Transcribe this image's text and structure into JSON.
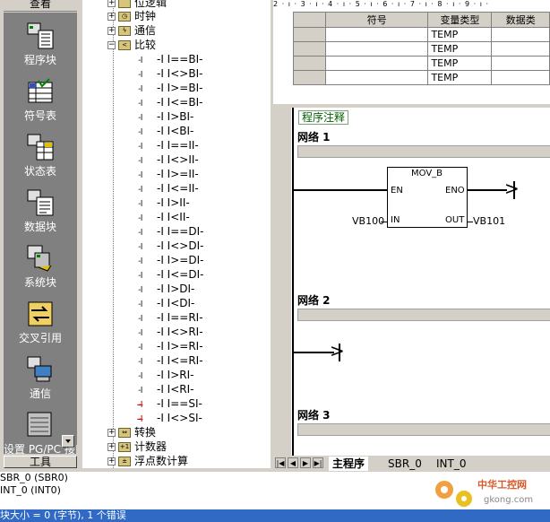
{
  "navbar": {
    "title": "查看",
    "items": [
      {
        "label": "程序块",
        "icon": "program-block-icon"
      },
      {
        "label": "符号表",
        "icon": "symbol-table-icon"
      },
      {
        "label": "状态表",
        "icon": "status-chart-icon"
      },
      {
        "label": "数据块",
        "icon": "data-block-icon"
      },
      {
        "label": "系统块",
        "icon": "system-block-icon"
      },
      {
        "label": "交叉引用",
        "icon": "cross-reference-icon"
      },
      {
        "label": "通信",
        "icon": "communication-icon"
      },
      {
        "label": "设置 PG/PC 接口",
        "icon": "set-pg-pc-icon"
      }
    ],
    "footer": "工具"
  },
  "tree": {
    "top_partial": "位逻辑",
    "folders_top": [
      "时钟",
      "通信"
    ],
    "compare_folder": "比较",
    "compare_items": [
      "-I  I==BI-",
      "-I  I<>BI-",
      "-I  I>=BI-",
      "-I  I<=BI-",
      "-I  I>BI-",
      "-I  I<BI-",
      "-I  I==II-",
      "-I  I<>II-",
      "-I  I>=II-",
      "-I  I<=II-",
      "-I  I>II-",
      "-I  I<II-",
      "-I  I==DI-",
      "-I  I<>DI-",
      "-I  I>=DI-",
      "-I  I<=DI-",
      "-I  I>DI-",
      "-I  I<DI-",
      "-I  I==RI-",
      "-I  I<>RI-",
      "-I  I>=RI-",
      "-I  I<=RI-",
      "-I  I>RI-",
      "-I  I<RI-",
      "-I  I==SI-",
      "-I  I<>SI-"
    ],
    "folders_bottom": [
      "转换",
      "计数器",
      "浮点数计算"
    ]
  },
  "symbol_table": {
    "ruler": "2 · ı · 3 · ı · 4 · ı · 5 · ı · 6 · ı · 7 · ı · 8 · ı · 9 · ı ·",
    "headers": [
      "符号",
      "变量类型",
      "数据类"
    ],
    "rows": [
      {
        "symbol": "",
        "var_type": "TEMP",
        "data_type": ""
      },
      {
        "symbol": "",
        "var_type": "TEMP",
        "data_type": ""
      },
      {
        "symbol": "",
        "var_type": "TEMP",
        "data_type": ""
      },
      {
        "symbol": "",
        "var_type": "TEMP",
        "data_type": ""
      }
    ]
  },
  "editor": {
    "program_comment": "程序注释",
    "networks": [
      "网络 1",
      "网络 2",
      "网络 3"
    ],
    "mov_box": {
      "title": "MOV_B",
      "en": "EN",
      "eno": "ENO",
      "in": "IN",
      "out": "OUT",
      "in_operand": "VB100",
      "out_operand": "VB101"
    }
  },
  "tabs": {
    "items": [
      "主程序",
      "SBR_0",
      "INT_0"
    ],
    "active": "主程序"
  },
  "output": {
    "lines": [
      "SBR_0 (SBR0)",
      "INT_0 (INT0)"
    ]
  },
  "status": {
    "text": "块大小 = 0 (字节), 1 个错误"
  },
  "watermark": {
    "text": "中华工控网",
    "url": "gkong.com"
  },
  "colors": {
    "nav_bg": "#808080",
    "status_bg": "#316ac5",
    "comment_green": "#006000"
  }
}
